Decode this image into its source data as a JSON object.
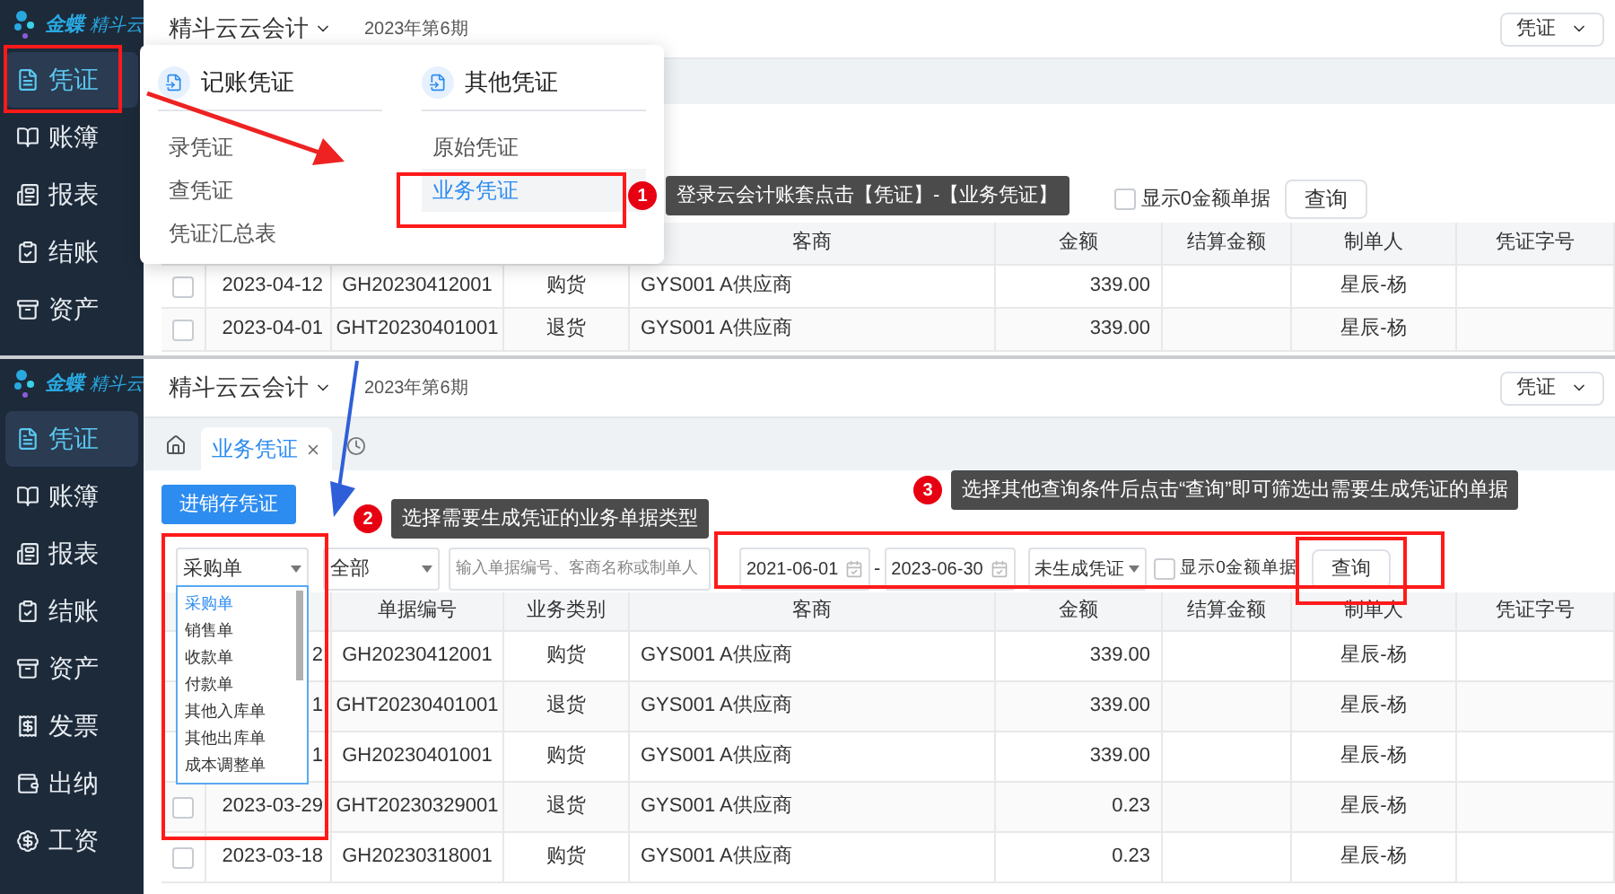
{
  "top_screen": {
    "logo": {
      "brand": "金蝶",
      "product": "精斗云"
    },
    "sidebar": [
      {
        "label": "凭证",
        "selected": true
      },
      {
        "label": "账簿",
        "selected": false
      },
      {
        "label": "报表",
        "selected": false
      },
      {
        "label": "结账",
        "selected": false
      },
      {
        "label": "资产",
        "selected": false
      }
    ],
    "header": {
      "book": "精斗云云会计",
      "period": "2023年第6期",
      "module": "凭证"
    },
    "filters": {
      "zero_amount": {
        "label": "显示0金额单据",
        "checked": false
      },
      "query_button": "查询"
    },
    "table": {
      "columns": [
        "客商",
        "金额",
        "结算金额",
        "制单人",
        "凭证字号"
      ],
      "rows": [
        {
          "checked": false,
          "date": "2023-04-12",
          "number": "GH20230412001",
          "type": "购货",
          "partner": "GYS001 A供应商",
          "amount": "339.00",
          "maker": "星辰-杨"
        },
        {
          "checked": false,
          "date": "2023-04-01",
          "number": "GHT20230401001",
          "type": "退货",
          "partner": "GYS001 A供应商",
          "amount": "339.00",
          "maker": "星辰-杨"
        }
      ]
    },
    "menu": {
      "groups": [
        {
          "title": "记账凭证",
          "items": [
            {
              "label": "录凭证",
              "selected": false
            },
            {
              "label": "查凭证",
              "selected": false
            },
            {
              "label": "凭证汇总表",
              "selected": false
            }
          ]
        },
        {
          "title": "其他凭证",
          "items": [
            {
              "label": "原始凭证",
              "selected": false
            },
            {
              "label": "业务凭证",
              "selected": true
            }
          ]
        }
      ]
    },
    "callout": {
      "number": "1",
      "text": "登录云会计账套点击【凭证】-【业务凭证】"
    }
  },
  "bottom_screen": {
    "logo": {
      "brand": "金蝶",
      "product": "精斗云"
    },
    "sidebar": [
      {
        "label": "凭证",
        "selected": true
      },
      {
        "label": "账簿",
        "selected": false
      },
      {
        "label": "报表",
        "selected": false
      },
      {
        "label": "结账",
        "selected": false
      },
      {
        "label": "资产",
        "selected": false
      },
      {
        "label": "发票",
        "selected": false
      },
      {
        "label": "出纳",
        "selected": false
      },
      {
        "label": "工资",
        "selected": false
      }
    ],
    "header": {
      "book": "精斗云云会计",
      "period": "2023年第6期",
      "module": "凭证"
    },
    "tabs": [
      {
        "label": "业务凭证",
        "selected": true
      }
    ],
    "action_button": "进销存凭证",
    "filters": {
      "type_select": {
        "value": "采购单",
        "expanded": true,
        "options": [
          {
            "label": "采购单",
            "selected": true
          },
          {
            "label": "销售单",
            "selected": false
          },
          {
            "label": "收款单",
            "selected": false
          },
          {
            "label": "付款单",
            "selected": false
          },
          {
            "label": "其他入库单",
            "selected": false
          },
          {
            "label": "其他出库单",
            "selected": false
          },
          {
            "label": "成本调整单",
            "selected": false
          }
        ]
      },
      "category_select": "全部",
      "search": {
        "placeholder": "输入单据编号、客商名称或制单人"
      },
      "date_from": "2021-06-01",
      "date_to": "2023-06-30",
      "date_separator": "-",
      "status_select": "未生成凭证",
      "zero_amount": {
        "label": "显示0金额单据",
        "checked": false
      },
      "query_button": "查询"
    },
    "table": {
      "columns": [
        "单据编号",
        "业务类别",
        "客商",
        "金额",
        "结算金额",
        "制单人",
        "凭证字号"
      ],
      "rows": [
        {
          "date": "2",
          "number": "GH20230412001",
          "type": "购货",
          "partner": "GYS001 A供应商",
          "amount": "339.00",
          "maker": "星辰-杨"
        },
        {
          "date": "1",
          "number": "GHT20230401001",
          "type": "退货",
          "partner": "GYS001 A供应商",
          "amount": "339.00",
          "maker": "星辰-杨"
        },
        {
          "date": "1",
          "number": "GH20230401001",
          "type": "购货",
          "partner": "GYS001 A供应商",
          "amount": "339.00",
          "maker": "星辰-杨"
        },
        {
          "checked": false,
          "date": "2023-03-29",
          "number": "GHT20230329001",
          "type": "退货",
          "partner": "GYS001 A供应商",
          "amount": "0.23",
          "maker": "星辰-杨"
        },
        {
          "checked": false,
          "date": "2023-03-18",
          "number": "GH20230318001",
          "type": "购货",
          "partner": "GYS001 A供应商",
          "amount": "0.23",
          "maker": "星辰-杨"
        }
      ]
    },
    "callouts": [
      {
        "number": "2",
        "text": "选择需要生成凭证的业务单据类型"
      },
      {
        "number": "3",
        "text": "选择其他查询条件后点击“查询”即可筛选出需要生成凭证的单据"
      }
    ]
  }
}
